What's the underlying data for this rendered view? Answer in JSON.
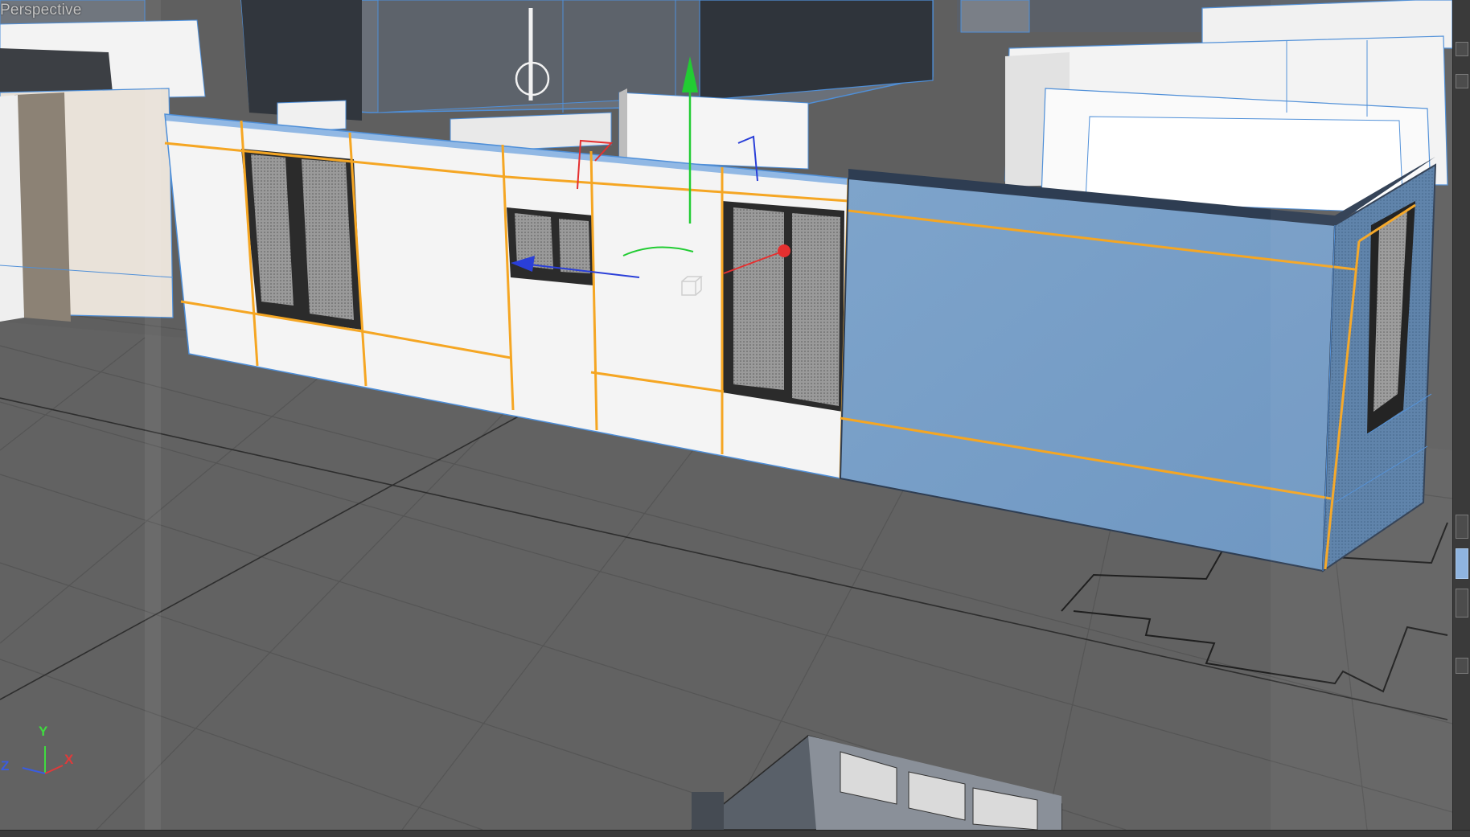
{
  "viewport": {
    "label": "Perspective",
    "camera": "perspective",
    "shading": "textured-wireframe",
    "selection_color": "#f5a623",
    "wireframe_color": "#4f8fd8"
  },
  "gizmo": {
    "mode": "move",
    "axis_colors": {
      "x": "#e53030",
      "y": "#22cc33",
      "z": "#2a3fd8"
    }
  },
  "axis_indicator": {
    "x_label": "X",
    "y_label": "Y",
    "z_label": "Z"
  },
  "side_toolbar": {
    "buttons": [
      "tool-button",
      "tool-button",
      "tool-button",
      "tool-button-active",
      "tool-button",
      "tool-button"
    ]
  }
}
